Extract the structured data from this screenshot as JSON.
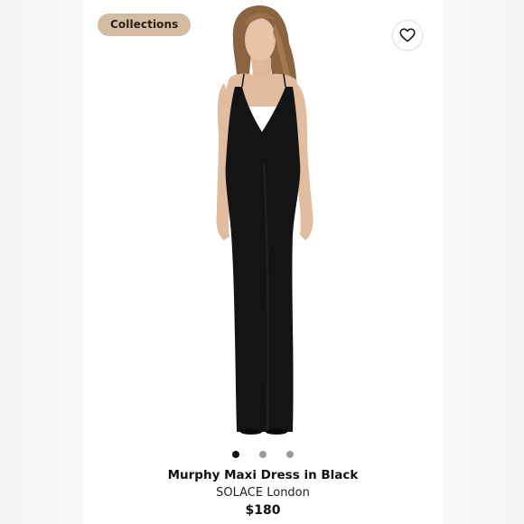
{
  "listing": {
    "badge_label": "Collections",
    "favorite_icon": "heart-icon",
    "title": "Murphy Maxi Dress in Black",
    "brand": "SOLACE London",
    "price": "$180"
  },
  "carousel": {
    "count": 3,
    "active_index": 0,
    "active_color": "#111111",
    "inactive_color": "#9a9a9a"
  },
  "colors": {
    "badge_bg": "#d6bba3",
    "dress": "#141414",
    "hair": "#8a6440",
    "skin": "#e4bfa3"
  }
}
